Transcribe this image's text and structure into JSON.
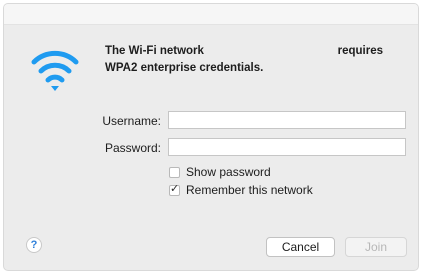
{
  "message": {
    "line1_left": "The Wi-Fi network",
    "line1_right": "requires",
    "line2": "WPA2 enterprise credentials."
  },
  "form": {
    "username_label": "Username:",
    "username_value": "",
    "password_label": "Password:",
    "password_value": "",
    "show_password_label": "Show password",
    "show_password_checked": false,
    "remember_label": "Remember this network",
    "remember_checked": true
  },
  "buttons": {
    "help": "?",
    "cancel": "Cancel",
    "join": "Join"
  },
  "icons": {
    "wifi": "wifi-icon",
    "help": "help-icon",
    "checkmark": "checkmark-icon"
  },
  "colors": {
    "wifi_blue": "#1f9bf0",
    "dialog_bg": "#ececec"
  }
}
